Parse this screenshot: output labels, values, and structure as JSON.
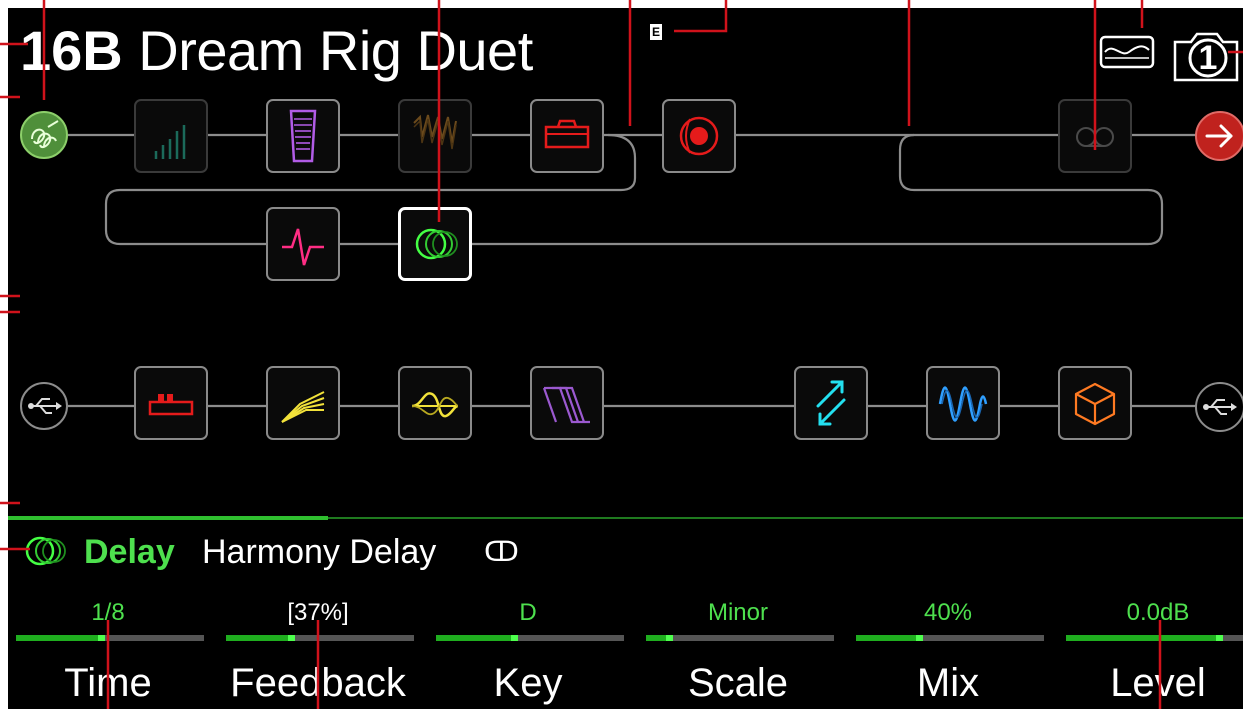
{
  "preset": {
    "number": "16B",
    "name": "Dream Rig Duet",
    "badge": "E"
  },
  "header_icons": [
    "snapshot-eq-icon",
    "camera-icon"
  ],
  "snapshot_number": "1",
  "signal_path_1": {
    "input": "guitar-input-icon",
    "blocks": [
      {
        "name": "eq-graphic-icon",
        "bypassed": true
      },
      {
        "name": "volume-pedal-icon",
        "bypassed": false
      },
      {
        "name": "wah-icon",
        "bypassed": true
      },
      {
        "name": "amp-icon",
        "bypassed": false
      },
      {
        "name": "cab-icon",
        "bypassed": false
      },
      {
        "name": "looper-icon",
        "bypassed": true
      }
    ],
    "lower_blocks": [
      {
        "name": "dynamics-icon",
        "bypassed": false
      },
      {
        "name": "delay-icon",
        "bypassed": false,
        "selected": true
      }
    ],
    "output": "multi-output-icon"
  },
  "signal_path_2": {
    "input": "usb-input-icon",
    "blocks": [
      {
        "name": "distortion-icon"
      },
      {
        "name": "compressor-icon"
      },
      {
        "name": "filter-icon"
      },
      {
        "name": "pitch-icon"
      },
      {
        "name": "send-return-icon"
      },
      {
        "name": "modulation-icon"
      },
      {
        "name": "reverb-icon"
      }
    ],
    "output": "usb-output-icon"
  },
  "selected_block": {
    "category": "Delay",
    "model": "Harmony Delay",
    "stereo_symbol": "ↀ"
  },
  "params": [
    {
      "label": "Time",
      "value": "1/8",
      "level": 0.44,
      "highlight": false
    },
    {
      "label": "Feedback",
      "value": "[37%]",
      "level": 0.34,
      "highlight": true
    },
    {
      "label": "Key",
      "value": "D",
      "level": 0.42,
      "highlight": false
    },
    {
      "label": "Scale",
      "value": "Minor",
      "level": 0.12,
      "highlight": false
    },
    {
      "label": "Mix",
      "value": "40%",
      "level": 0.33,
      "highlight": false
    },
    {
      "label": "Level",
      "value": "0.0dB",
      "level": 0.82,
      "highlight": false
    }
  ],
  "colors": {
    "accent_green": "#4ee04e",
    "param_value": "#4ee04e",
    "callout_red": "#d0121b",
    "output_red": "#c0221e",
    "input_green": "#4f8f3a"
  }
}
